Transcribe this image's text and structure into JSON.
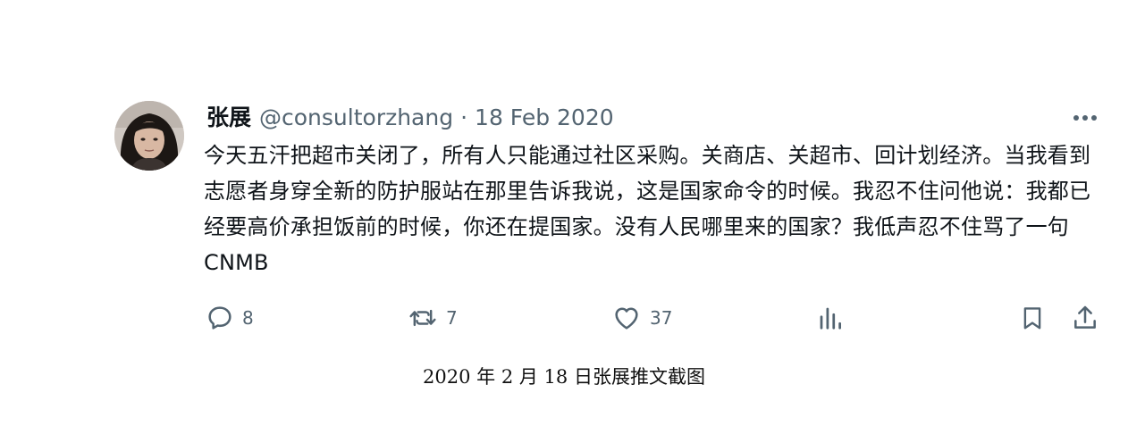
{
  "tweet": {
    "display_name": "张展",
    "handle": "@consultorzhang",
    "separator": "·",
    "date": "18 Feb 2020",
    "text": "今天五汗把超市关闭了，所有人只能通过社区采购。关商店、关超市、回计划经济。当我看到志愿者身穿全新的防护服站在那里告诉我说，这是国家命令的时候。我忍不住问他说：我都已经要高价承担饭前的时候，你还在提国家。没有人民哪里来的国家？我低声忍不住骂了一句CNMB",
    "more_icon": "more-horizontal-icon",
    "avatar_icon": "profile-photo",
    "actions": {
      "reply": {
        "icon": "reply-icon",
        "count": "8"
      },
      "retweet": {
        "icon": "retweet-icon",
        "count": "7"
      },
      "like": {
        "icon": "heart-icon",
        "count": "37"
      },
      "views": {
        "icon": "analytics-icon"
      },
      "bookmark": {
        "icon": "bookmark-icon"
      },
      "share": {
        "icon": "share-icon"
      }
    },
    "colors": {
      "text": "#0f1419",
      "secondary": "#536471"
    }
  },
  "caption": "2020 年 2 月 18 日张展推文截图"
}
